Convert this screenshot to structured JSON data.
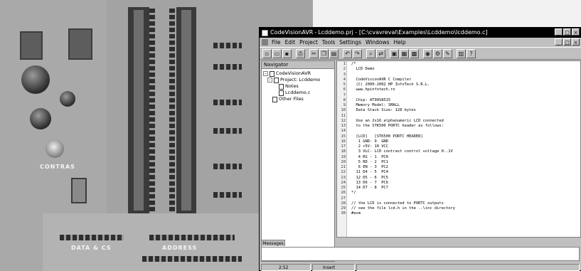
{
  "window": {
    "app_name": "CodeVisionAVR",
    "separator": "-",
    "document_title": "Lcddemo.prj - [C:\\cvavreval\\Examples\\Lcddemo\\lcddemo.c]",
    "buttons": {
      "minimize": "_",
      "maximize": "□",
      "close": "×"
    }
  },
  "menu": {
    "items": [
      "File",
      "Edit",
      "Project",
      "Tools",
      "Settings",
      "Windows",
      "Help"
    ]
  },
  "toolbar": {
    "icons": [
      "new-icon",
      "open-icon",
      "save-icon",
      "print-icon",
      "cut-icon",
      "copy-icon",
      "paste-icon",
      "undo-icon",
      "redo-icon",
      "find-icon",
      "replace-icon",
      "compile-icon",
      "make-icon",
      "chip-icon",
      "debug-icon",
      "settings-icon",
      "wizard-icon",
      "terminal-icon",
      "help-icon"
    ]
  },
  "navigator": {
    "header": "Navigator",
    "tree": [
      {
        "label": "CodeVisionAVR",
        "level": 0,
        "expander": "-"
      },
      {
        "label": "Project: Lcddemo",
        "level": 1,
        "expander": "-"
      },
      {
        "label": "Notes",
        "level": 2,
        "expander": ""
      },
      {
        "label": "Lcddemo.c",
        "level": 2,
        "expander": ""
      },
      {
        "label": "Other Files",
        "level": 1,
        "expander": ""
      }
    ]
  },
  "editor": {
    "lines": [
      "/*",
      "  LCD Demo",
      "",
      "  CodeVisionAVR C Compiler",
      "  (C) 2000-2002 HP InfoTech S.R.L.",
      "  www.hpinfotech.ro",
      "",
      "  Chip: AT90S8515",
      "  Memory Model: SMALL",
      "  Data Stack Size: 128 bytes",
      "",
      "  Use an 2x16 alphanumeric LCD connected",
      "  to the STK500 PORTC header as follows:",
      "",
      "  [LCD]   [STK500 PORTC HEADER]",
      "   1 GND- 9  GND",
      "   2 +5V- 10 VCC",
      "   3 VLC- LCD contrast control voltage 0..1V",
      "   4 RS - 1  PC0",
      "   5 RD - 2  PC1",
      "   6 EN - 3  PC2",
      "  11 D4 - 5  PC4",
      "  12 D5 - 6  PC5",
      "  13 D6 - 7  PC6",
      "  14 D7 - 8  PC7",
      "*/",
      "",
      "// the LCD is connected to PORTC outputs",
      "// see the file lcd.h in the ..\\inc directory",
      "#asm"
    ]
  },
  "messages": {
    "tab_label": "Messages"
  },
  "status": {
    "position": "2:52",
    "mode": "Insert"
  },
  "board": {
    "labels": [
      "DATA & CS",
      "ADDRESS",
      "CONTRAS"
    ]
  }
}
